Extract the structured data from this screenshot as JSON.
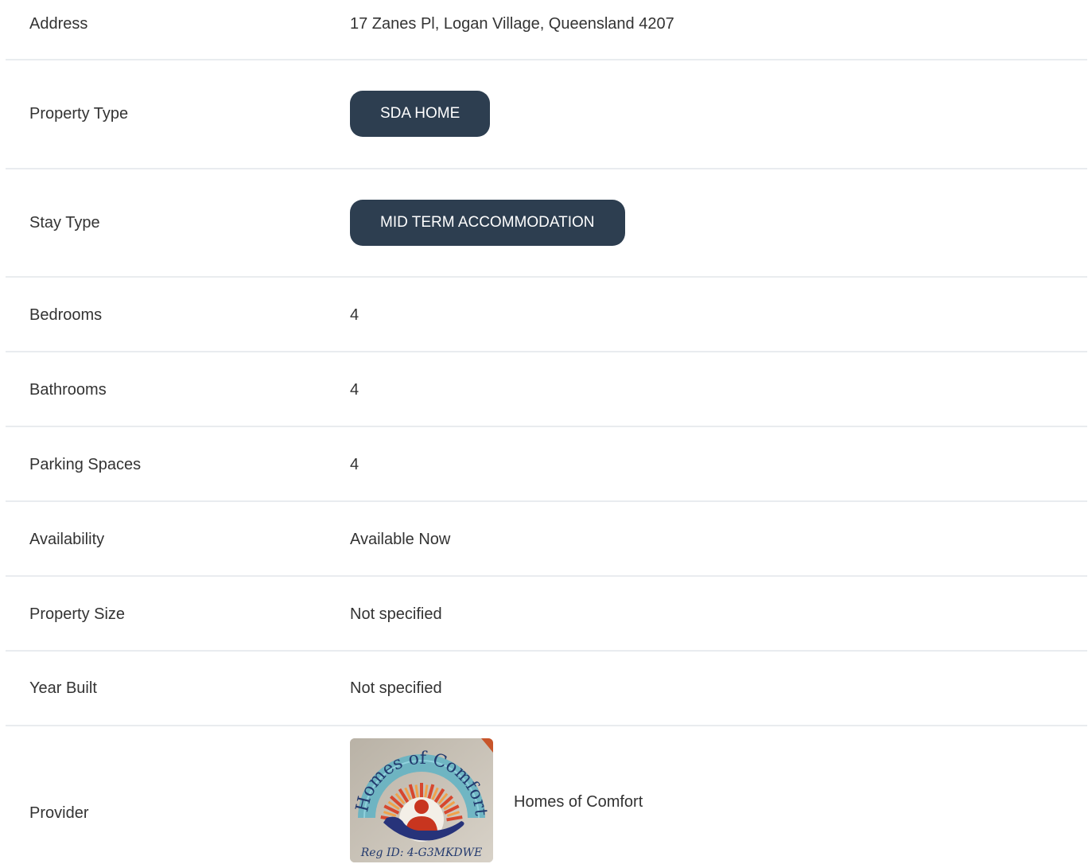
{
  "rows": {
    "address": {
      "label": "Address",
      "value": "17 Zanes Pl, Logan Village, Queensland 4207"
    },
    "property_type": {
      "label": "Property Type",
      "value": "SDA HOME"
    },
    "stay_type": {
      "label": "Stay Type",
      "value": "MID TERM ACCOMMODATION"
    },
    "bedrooms": {
      "label": "Bedrooms",
      "value": "4"
    },
    "bathrooms": {
      "label": "Bathrooms",
      "value": "4"
    },
    "parking": {
      "label": "Parking Spaces",
      "value": "4"
    },
    "availability": {
      "label": "Availability",
      "value": "Available Now"
    },
    "property_size": {
      "label": "Property Size",
      "value": "Not specified"
    },
    "year_built": {
      "label": "Year Built",
      "value": "Not specified"
    },
    "provider": {
      "label": "Provider",
      "name": "Homes of Comfort",
      "logo_text": "Homes of Comfort",
      "logo_reg": "Reg ID: 4-G3MKDWE"
    }
  },
  "colors": {
    "pill_bg": "#2d3e50",
    "divider": "#e9ecef",
    "text": "#333333"
  }
}
